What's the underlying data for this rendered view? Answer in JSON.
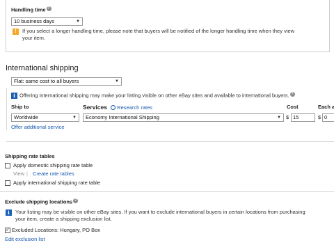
{
  "handling": {
    "label": "Handling time",
    "help_icon": "help-icon",
    "selected": "10 business days",
    "warning_icon": "warning-icon",
    "warning_text_1": "If you select a longer handling time, please note that buyers will be notified of the longer handling time when they view",
    "warning_text_2": "your item."
  },
  "international": {
    "heading": "International shipping",
    "method_selected": "Flat: same cost to all buyers",
    "info_text": "Offering international shipping may make your listing visible on other eBay sites and available to international buyers.",
    "headers": {
      "ship_to": "Ship to",
      "services": "Services",
      "research_rates": "Research rates",
      "cost": "Cost",
      "each_additional": "Each a"
    },
    "row": {
      "ship_to": "Worldwide",
      "service": "Economy International Shipping",
      "currency": "$",
      "cost": "15",
      "each_currency": "$",
      "each_value": "0"
    },
    "offer_additional": "Offer additional service"
  },
  "rate_tables": {
    "heading": "Shipping rate tables",
    "domestic_label": "Apply domestic shipping rate table",
    "view": "View",
    "separator": "|",
    "create": "Create rate tables",
    "international_label": "Apply international shipping rate table"
  },
  "exclude": {
    "heading": "Exclude shipping locations",
    "info_text_1": "Your listing may be visible on other eBay sites. If you want to exclude international buyers in certain locations from purchasing",
    "info_text_2": "your item, create a shipping exclusion list.",
    "excluded_label": "Excluded Locations: Hungary, PO Box",
    "edit_link": "Edit exclusion list"
  },
  "colors": {
    "link": "#1558b0",
    "info_icon": "#1a5fb4",
    "warning_icon": "#f5a623"
  }
}
